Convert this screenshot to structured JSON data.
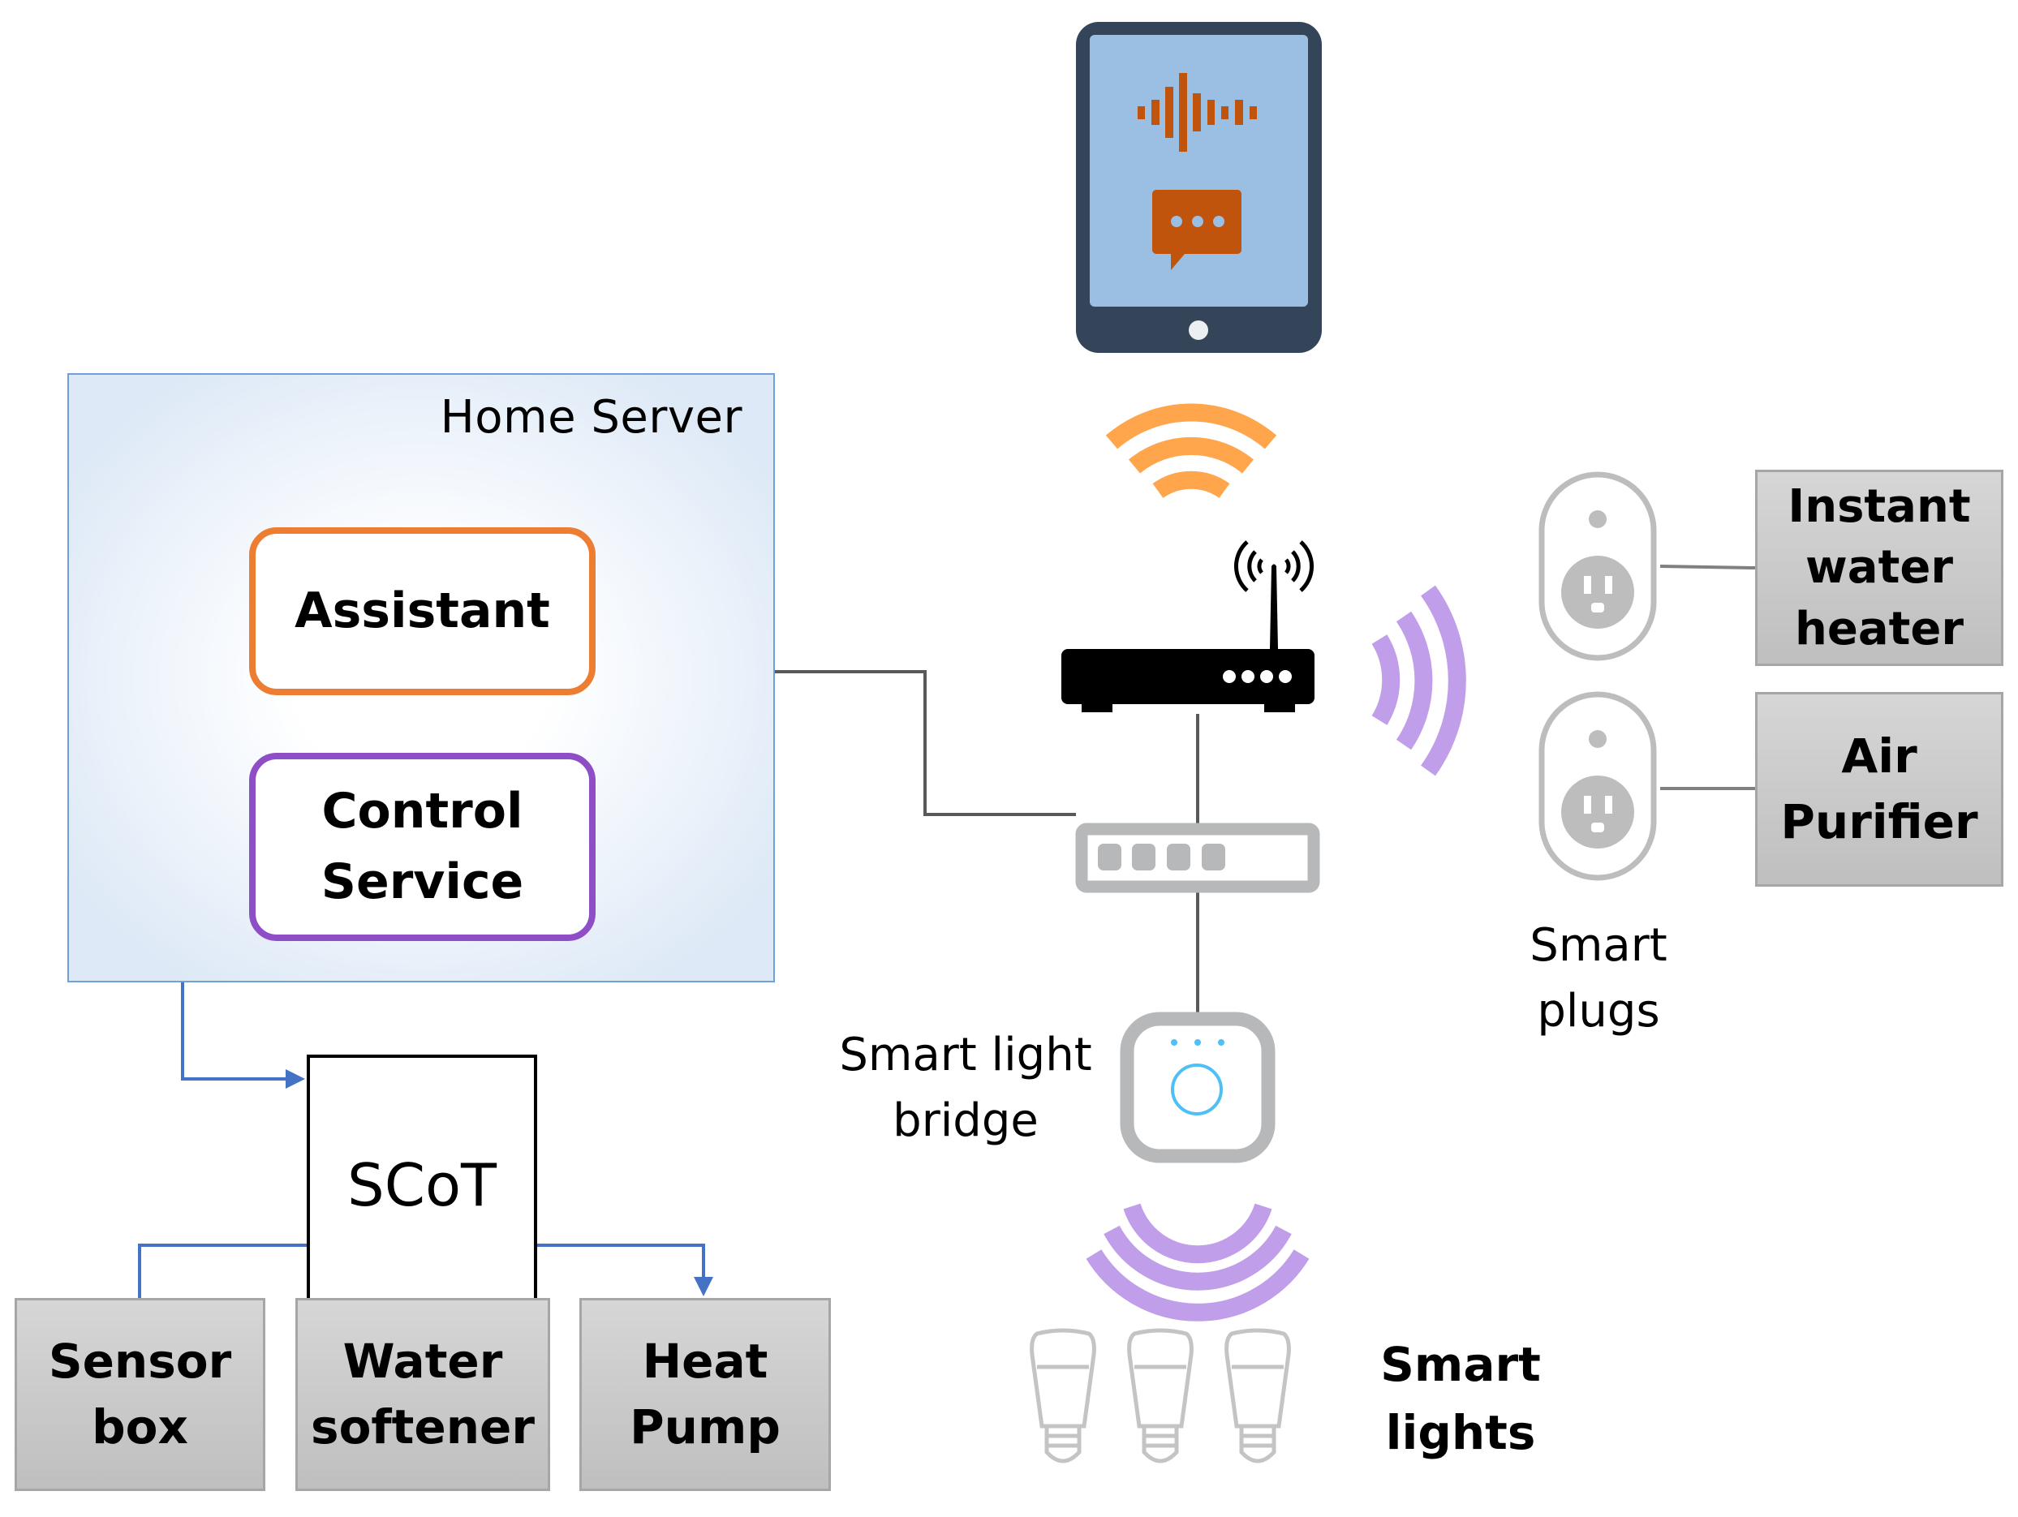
{
  "diagram": {
    "home_server": {
      "title": "Home Server",
      "icon": "server-icon"
    },
    "assistant": {
      "label": "Assistant",
      "border_color": "#ed7d31"
    },
    "control_service": {
      "label": "Control\nService",
      "border_color": "#8e4ec6"
    },
    "scot": {
      "label": "SCoT"
    },
    "local_devices": [
      {
        "label": "Sensor\nbox"
      },
      {
        "label": "Water\nsoftener"
      },
      {
        "label": "Heat\nPump"
      }
    ],
    "tablet": {
      "icons": [
        "voice-waveform-icon",
        "chat-bubble-icon"
      ]
    },
    "router": {
      "icon": "wifi-router-icon"
    },
    "network_switch": {
      "icon": "network-switch-icon"
    },
    "smart_light_bridge": {
      "label": "Smart light\nbridge",
      "icon": "hue-bridge-icon"
    },
    "smart_lights": {
      "label": "Smart\nlights",
      "count": 3,
      "icon": "light-bulb-icon"
    },
    "smart_plugs": {
      "label": "Smart\nplugs",
      "icon": "smart-plug-icon",
      "connected": [
        {
          "label": "Instant\nwater\nheater"
        },
        {
          "label": "Air\nPurifier"
        }
      ]
    },
    "colors": {
      "arrow_blue": "#4472c4",
      "wire_gray": "#595959",
      "wifi_orange": "#ffa64d",
      "zigbee_purple": "#c09ee9",
      "tablet_frame": "#34455a",
      "tablet_screen": "#9bbee3",
      "tablet_icon": "#c0540c",
      "device_gray": "#b7b8ba",
      "bridge_blue": "#4ec0f5"
    }
  }
}
